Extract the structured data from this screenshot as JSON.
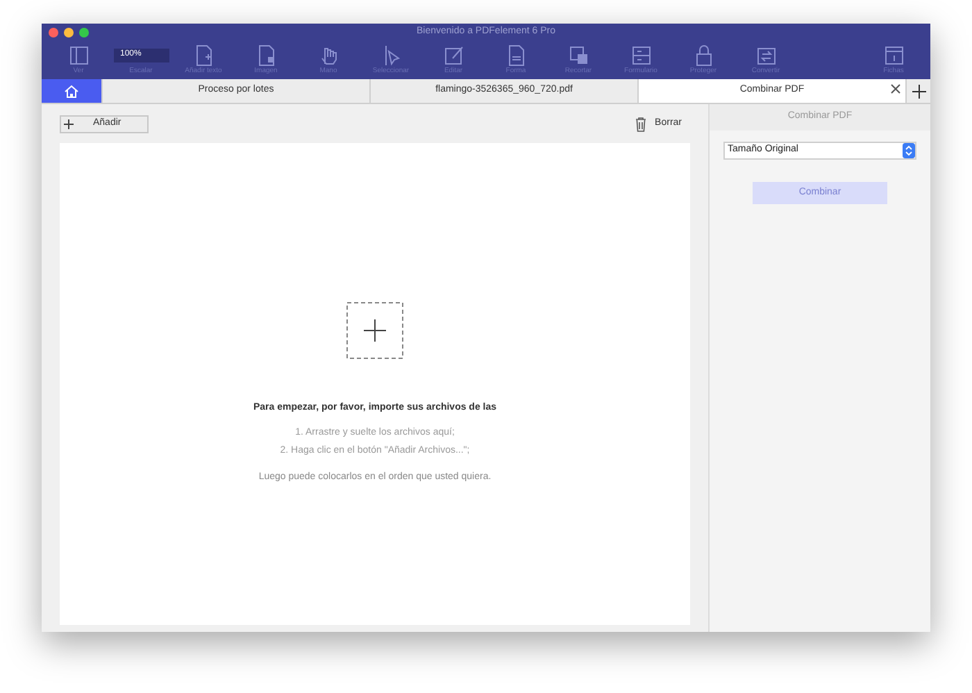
{
  "window": {
    "title": "Bienvenido a PDFelement 6 Pro"
  },
  "toolbar": {
    "zoom_value": "100%",
    "items": [
      {
        "kind": "view",
        "label": "Ver"
      },
      {
        "kind": "zoom",
        "label": "Escalar"
      },
      {
        "kind": "addtext",
        "label": "Añadir texto"
      },
      {
        "kind": "addimage",
        "label": "Imagen"
      },
      {
        "kind": "hand",
        "label": "Mano"
      },
      {
        "kind": "select",
        "label": "Seleccionar"
      },
      {
        "kind": "edit",
        "label": "Editar"
      },
      {
        "kind": "form",
        "label": "Forma"
      },
      {
        "kind": "crop",
        "label": "Recortar"
      },
      {
        "kind": "forms",
        "label": "Formulario"
      },
      {
        "kind": "protect",
        "label": "Proteger"
      },
      {
        "kind": "convert",
        "label": "Convertir"
      },
      {
        "kind": "page",
        "label": "Fichas"
      }
    ]
  },
  "tabs": [
    {
      "label": "Proceso por lotes",
      "selected": false
    },
    {
      "label": "flamingo-3526365_960_720.pdf",
      "selected": false
    },
    {
      "label": "Combinar PDF",
      "selected": true,
      "closable": true
    }
  ],
  "actions": {
    "add": "Añadir",
    "delete": "Borrar"
  },
  "drop_area": {
    "heading": "Para empezar, por favor, importe sus archivos de las",
    "steps": [
      "1. Arrastre y suelte los archivos aquí;",
      "2. Haga clic en el botón \"Añadir Archivos...\";"
    ],
    "note": "Luego puede colocarlos en el orden que usted quiera."
  },
  "side_panel": {
    "title": "Combinar PDF",
    "size_select": "Tamaño Original",
    "combine_button": {
      "label": "Combinar",
      "disabled": true
    }
  }
}
